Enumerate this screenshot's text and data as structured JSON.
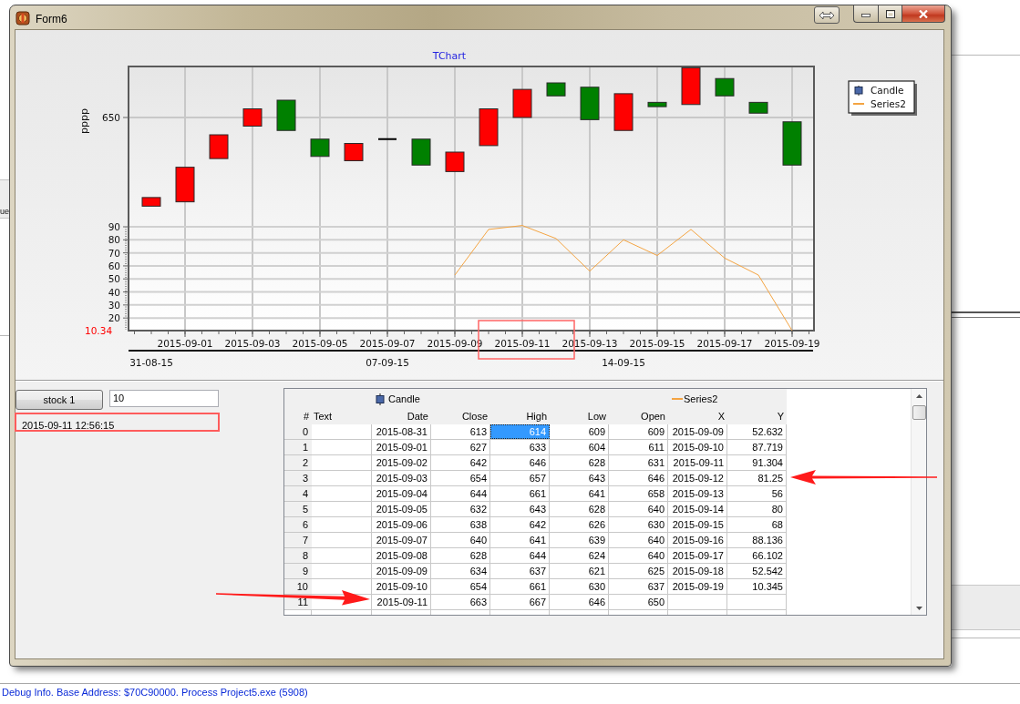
{
  "window": {
    "title": "Form6"
  },
  "chart": {
    "axis_title": "dddd",
    "candle_series": {
      "name": "Candle"
    },
    "candle_axis_labels": [
      "650"
    ],
    "axis_value_label": "10.34",
    "date_axis_labels": [
      "31-08-15",
      "07-09-15",
      "14-09-15"
    ],
    "chart_data": {
      "type": "line",
      "title": "TChart",
      "categories": [
        null,
        "2015-09-01",
        null,
        "2015-09-03",
        null,
        "2015-09-05",
        null,
        "2015-09-07",
        null,
        "2015-09-09",
        null,
        "2015-09-11",
        null,
        "2015-09-13",
        null,
        "2015-09-15",
        null,
        "2015-09-17",
        null,
        "2015-09-19"
      ],
      "series": [
        {
          "name": "Series2",
          "color": "#f4a442",
          "values": [
            null,
            null,
            null,
            null,
            null,
            null,
            null,
            null,
            null,
            53,
            88,
            91,
            81,
            56,
            80,
            68,
            88,
            66,
            53,
            10.35
          ]
        }
      ],
      "ylim": [
        10.34,
        213
      ],
      "yticks": [
        {
          "value": 20,
          "label": "20"
        },
        {
          "value": 30,
          "label": "30"
        },
        {
          "value": 40,
          "label": "40"
        },
        {
          "value": 50,
          "label": "50"
        },
        {
          "value": 60,
          "label": "60"
        },
        {
          "value": 70,
          "label": "70"
        },
        {
          "value": 80,
          "label": "80"
        },
        {
          "value": 90,
          "label": "90"
        }
      ],
      "grid": true
    }
  },
  "controls": {
    "button": {
      "label": "stock 1"
    },
    "input": {
      "value": "10"
    },
    "timestamp": "2015-09-11 12:56:15"
  },
  "grid": {
    "series_headers": [
      {
        "name": "Candle",
        "kind": "candle"
      },
      {
        "name": "Series2",
        "kind": "line"
      }
    ],
    "columns": [
      {
        "label": "#",
        "kind": "index"
      },
      {
        "label": "Text",
        "kind": "text"
      },
      {
        "label": "Date",
        "kind": "data"
      },
      {
        "label": "Close",
        "kind": "data"
      },
      {
        "label": "High",
        "kind": "data"
      },
      {
        "label": "Low",
        "kind": "data"
      },
      {
        "label": "Open",
        "kind": "data"
      },
      {
        "label": "X",
        "kind": "data"
      },
      {
        "label": "Y",
        "kind": "data"
      }
    ],
    "rows": [
      {
        "cells": [
          {
            "text": "0",
            "selected": false
          },
          {
            "text": "",
            "selected": false
          },
          {
            "text": "2015-08-31",
            "selected": false
          },
          {
            "text": "613",
            "selected": false
          },
          {
            "text": "614",
            "selected": true
          },
          {
            "text": "609",
            "selected": false
          },
          {
            "text": "609",
            "selected": false
          },
          {
            "text": "2015-09-09",
            "selected": false
          },
          {
            "text": "52.632",
            "selected": false
          }
        ]
      },
      {
        "cells": [
          {
            "text": "1",
            "selected": false
          },
          {
            "text": "",
            "selected": false
          },
          {
            "text": "2015-09-01",
            "selected": false
          },
          {
            "text": "627",
            "selected": false
          },
          {
            "text": "633",
            "selected": false
          },
          {
            "text": "604",
            "selected": false
          },
          {
            "text": "611",
            "selected": false
          },
          {
            "text": "2015-09-10",
            "selected": false
          },
          {
            "text": "87.719",
            "selected": false
          }
        ]
      },
      {
        "cells": [
          {
            "text": "2",
            "selected": false
          },
          {
            "text": "",
            "selected": false
          },
          {
            "text": "2015-09-02",
            "selected": false
          },
          {
            "text": "642",
            "selected": false
          },
          {
            "text": "646",
            "selected": false
          },
          {
            "text": "628",
            "selected": false
          },
          {
            "text": "631",
            "selected": false
          },
          {
            "text": "2015-09-11",
            "selected": false
          },
          {
            "text": "91.304",
            "selected": false
          }
        ]
      },
      {
        "cells": [
          {
            "text": "3",
            "selected": false
          },
          {
            "text": "",
            "selected": false
          },
          {
            "text": "2015-09-03",
            "selected": false
          },
          {
            "text": "654",
            "selected": false
          },
          {
            "text": "657",
            "selected": false
          },
          {
            "text": "643",
            "selected": false
          },
          {
            "text": "646",
            "selected": false
          },
          {
            "text": "2015-09-12",
            "selected": false
          },
          {
            "text": "81.25",
            "selected": false
          }
        ]
      },
      {
        "cells": [
          {
            "text": "4",
            "selected": false
          },
          {
            "text": "",
            "selected": false
          },
          {
            "text": "2015-09-04",
            "selected": false
          },
          {
            "text": "644",
            "selected": false
          },
          {
            "text": "661",
            "selected": false
          },
          {
            "text": "641",
            "selected": false
          },
          {
            "text": "658",
            "selected": false
          },
          {
            "text": "2015-09-13",
            "selected": false
          },
          {
            "text": "56",
            "selected": false
          }
        ]
      },
      {
        "cells": [
          {
            "text": "5",
            "selected": false
          },
          {
            "text": "",
            "selected": false
          },
          {
            "text": "2015-09-05",
            "selected": false
          },
          {
            "text": "632",
            "selected": false
          },
          {
            "text": "643",
            "selected": false
          },
          {
            "text": "628",
            "selected": false
          },
          {
            "text": "640",
            "selected": false
          },
          {
            "text": "2015-09-14",
            "selected": false
          },
          {
            "text": "80",
            "selected": false
          }
        ]
      },
      {
        "cells": [
          {
            "text": "6",
            "selected": false
          },
          {
            "text": "",
            "selected": false
          },
          {
            "text": "2015-09-06",
            "selected": false
          },
          {
            "text": "638",
            "selected": false
          },
          {
            "text": "642",
            "selected": false
          },
          {
            "text": "626",
            "selected": false
          },
          {
            "text": "630",
            "selected": false
          },
          {
            "text": "2015-09-15",
            "selected": false
          },
          {
            "text": "68",
            "selected": false
          }
        ]
      },
      {
        "cells": [
          {
            "text": "7",
            "selected": false
          },
          {
            "text": "",
            "selected": false
          },
          {
            "text": "2015-09-07",
            "selected": false
          },
          {
            "text": "640",
            "selected": false
          },
          {
            "text": "641",
            "selected": false
          },
          {
            "text": "639",
            "selected": false
          },
          {
            "text": "640",
            "selected": false
          },
          {
            "text": "2015-09-16",
            "selected": false
          },
          {
            "text": "88.136",
            "selected": false
          }
        ]
      },
      {
        "cells": [
          {
            "text": "8",
            "selected": false
          },
          {
            "text": "",
            "selected": false
          },
          {
            "text": "2015-09-08",
            "selected": false
          },
          {
            "text": "628",
            "selected": false
          },
          {
            "text": "644",
            "selected": false
          },
          {
            "text": "624",
            "selected": false
          },
          {
            "text": "640",
            "selected": false
          },
          {
            "text": "2015-09-17",
            "selected": false
          },
          {
            "text": "66.102",
            "selected": false
          }
        ]
      },
      {
        "cells": [
          {
            "text": "9",
            "selected": false
          },
          {
            "text": "",
            "selected": false
          },
          {
            "text": "2015-09-09",
            "selected": false
          },
          {
            "text": "634",
            "selected": false
          },
          {
            "text": "637",
            "selected": false
          },
          {
            "text": "621",
            "selected": false
          },
          {
            "text": "625",
            "selected": false
          },
          {
            "text": "2015-09-18",
            "selected": false
          },
          {
            "text": "52.542",
            "selected": false
          }
        ]
      },
      {
        "cells": [
          {
            "text": "10",
            "selected": false
          },
          {
            "text": "",
            "selected": false
          },
          {
            "text": "2015-09-10",
            "selected": false
          },
          {
            "text": "654",
            "selected": false
          },
          {
            "text": "661",
            "selected": false
          },
          {
            "text": "630",
            "selected": false
          },
          {
            "text": "637",
            "selected": false
          },
          {
            "text": "2015-09-19",
            "selected": false
          },
          {
            "text": "10.345",
            "selected": false
          }
        ]
      },
      {
        "cells": [
          {
            "text": "11",
            "selected": false
          },
          {
            "text": "",
            "selected": false
          },
          {
            "text": "2015-09-11",
            "selected": false
          },
          {
            "text": "663",
            "selected": false
          },
          {
            "text": "667",
            "selected": false
          },
          {
            "text": "646",
            "selected": false
          },
          {
            "text": "650",
            "selected": false
          },
          {
            "text": "",
            "selected": false
          },
          {
            "text": "",
            "selected": false
          }
        ]
      }
    ]
  },
  "debug_output": "Debug Info. Base Address: $70C90000. Process Project5.exe (5908)",
  "background_window": {
    "text": "ue"
  }
}
